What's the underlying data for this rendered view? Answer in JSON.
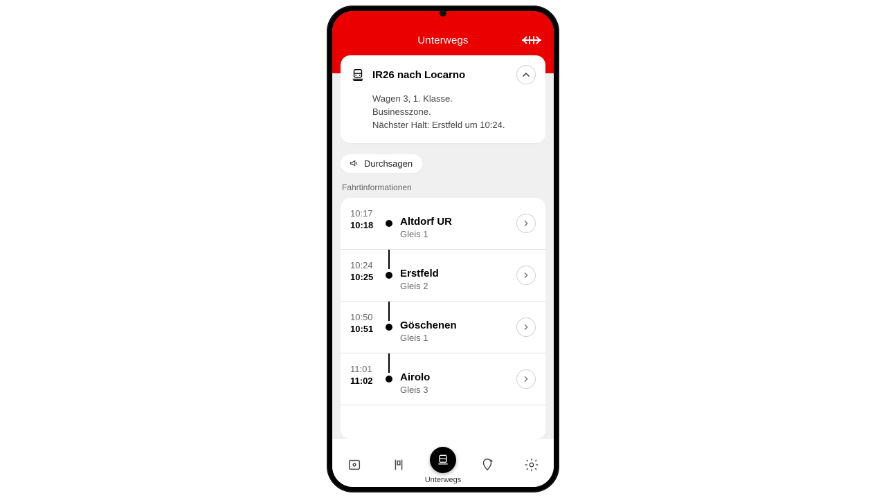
{
  "header": {
    "title": "Unterwegs",
    "train_title": "IR26 nach Locarno",
    "detail_line1": "Wagen 3, 1. Klasse.",
    "detail_line2": "Businesszone.",
    "detail_line3": "Nächster Halt: Erstfeld um 10:24."
  },
  "chip": {
    "label": "Durchsagen"
  },
  "section_label": "Fahrtinformationen",
  "stops": [
    {
      "arr": "10:17",
      "dep": "10:18",
      "name": "Altdorf UR",
      "platform": "Gleis 1"
    },
    {
      "arr": "10:24",
      "dep": "10:25",
      "name": "Erstfeld",
      "platform": "Gleis 2"
    },
    {
      "arr": "10:50",
      "dep": "10:51",
      "name": "Göschenen",
      "platform": "Gleis 1"
    },
    {
      "arr": "11:01",
      "dep": "11:02",
      "name": "Airolo",
      "platform": "Gleis 3"
    }
  ],
  "nav": {
    "active_label": "Unterwegs"
  },
  "colors": {
    "accent": "#EB0000"
  }
}
